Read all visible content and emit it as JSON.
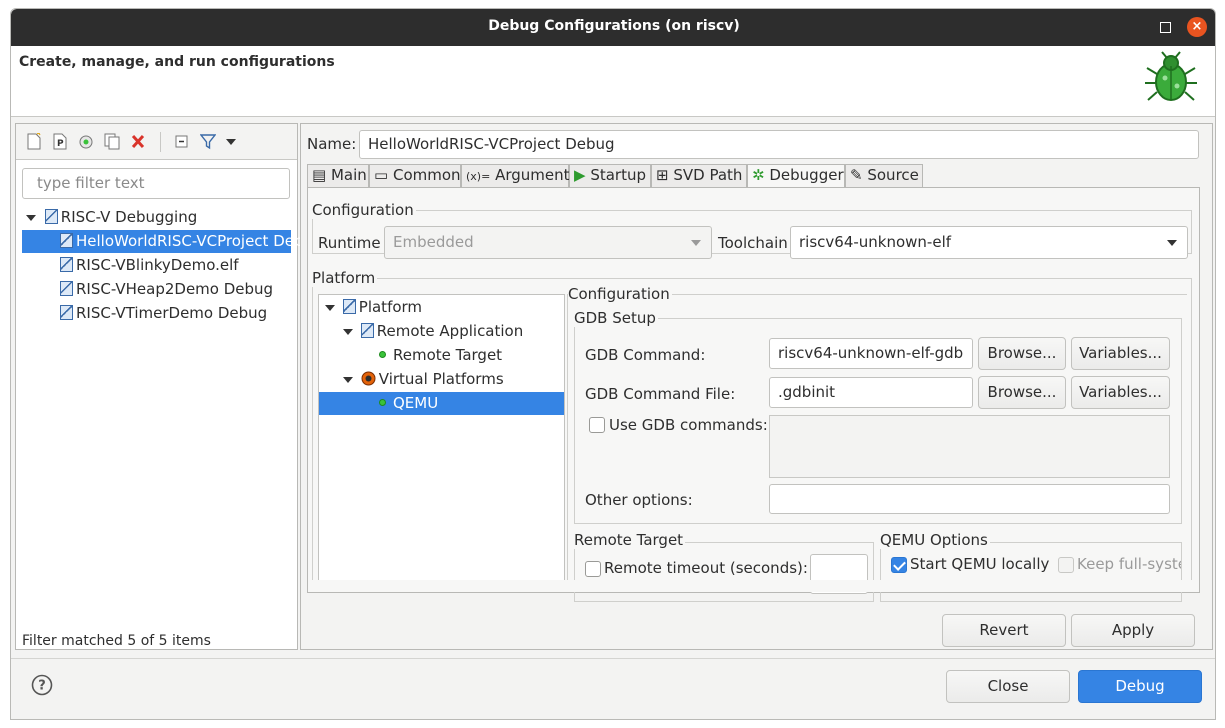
{
  "window": {
    "title": "Debug Configurations  (on riscv)"
  },
  "header": {
    "title": "Create, manage, and run configurations",
    "icon": "bug-icon"
  },
  "left": {
    "filter_placeholder": "type filter text",
    "tree": {
      "root": "RISC-V Debugging",
      "items": [
        "HelloWorldRISC-VCProject Debug",
        "RISC-VBlinkyDemo.elf",
        "RISC-VHeap2Demo Debug",
        "RISC-VTimerDemo Debug"
      ]
    },
    "status": "Filter matched 5 of 5 items"
  },
  "right": {
    "name_label": "Name:",
    "name_value": "HelloWorldRISC-VCProject Debug",
    "tabs": [
      "Main",
      "Common",
      "Arguments",
      "Startup",
      "SVD Path",
      "Debugger",
      "Source"
    ],
    "active_tab": "Debugger",
    "configuration": {
      "label": "Configuration",
      "runtime_label": "Runtime",
      "runtime_value": "Embedded",
      "toolchain_label": "Toolchain",
      "toolchain_value": "riscv64-unknown-elf"
    },
    "platform": {
      "label": "Platform",
      "tree": {
        "root": "Platform",
        "remote_app": "Remote Application",
        "remote_target": "Remote Target",
        "virtual_platforms": "Virtual Platforms",
        "qemu": "QEMU"
      },
      "config_label": "Configuration",
      "gdb_setup": {
        "label": "GDB Setup",
        "command_label": "GDB Command:",
        "command_value": "riscv64-unknown-elf-gdb",
        "command_file_label": "GDB Command File:",
        "command_file_value": ".gdbinit",
        "browse": "Browse...",
        "variables": "Variables...",
        "use_commands_label": "Use GDB commands:",
        "other_options_label": "Other options:",
        "other_options_value": ""
      },
      "remote_target_group": {
        "label": "Remote Target",
        "timeout_label": "Remote timeout (seconds):"
      },
      "qemu_options": {
        "label": "QEMU Options",
        "start_locally": "Start QEMU locally",
        "keep_full": "Keep full-system"
      }
    },
    "revert": "Revert",
    "apply": "Apply"
  },
  "footer": {
    "close": "Close",
    "debug": "Debug",
    "help_icon": "help-icon"
  }
}
